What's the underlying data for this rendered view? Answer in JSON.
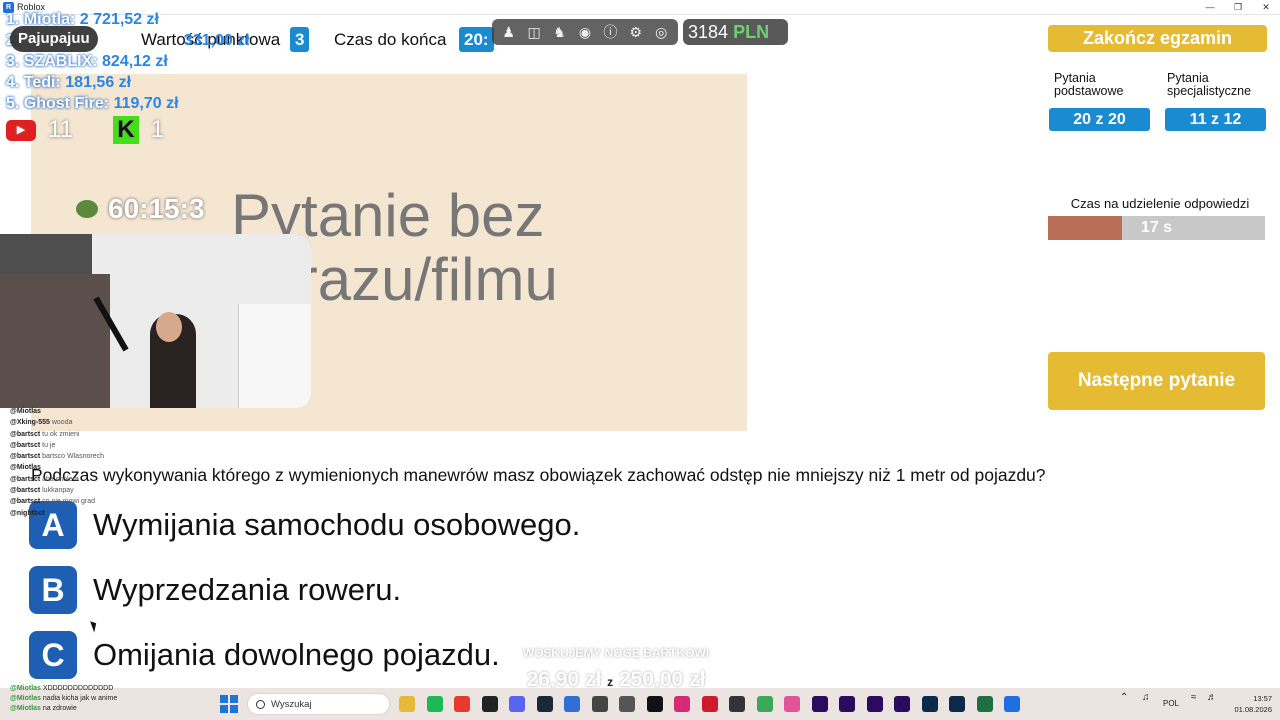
{
  "window": {
    "title": "Roblox",
    "icon": "roblox-icon"
  },
  "header": {
    "points_label": "Wartość punktowa",
    "points_value": "3",
    "time_label": "Czas do końca",
    "time_value": "20:",
    "currency_amount": "3184",
    "currency_unit": "PLN"
  },
  "roblox_menu": [
    "person-icon",
    "backpack-icon",
    "trophy-icon",
    "location-icon",
    "info-icon",
    "gear-icon",
    "shield-icon"
  ],
  "image_panel": {
    "placeholder": "Pytanie bez obrazu/filmu"
  },
  "sidebar": {
    "finish_button": "Zakończ egzamin",
    "basic_label": "Pytania podstawowe",
    "basic_counter": "20 z 20",
    "special_label": "Pytania specjalistyczne",
    "special_counter": "11 z 12",
    "time_label": "Czas na udzielenie odpowiedzi",
    "time_value": "17 s",
    "time_fraction": 0.34,
    "next_button": "Następne pytanie"
  },
  "question": {
    "text": "Podczas wykonywania którego z wymienionych manewrów masz obowiązek zachować odstęp nie mniejszy niż 1 metr od pojazdu?",
    "answers": [
      {
        "letter": "A",
        "text": "Wymijania samochodu osobowego."
      },
      {
        "letter": "B",
        "text": "Wyprzedzania roweru."
      },
      {
        "letter": "C",
        "text": "Omijania dowolnego pojazdu."
      }
    ]
  },
  "overlay": {
    "streamer": "Pajupajuu",
    "leaderboard": [
      {
        "name": "1. Miotla:",
        "value": "2 721,52 zł"
      },
      {
        "name": "2.",
        "value": "331,00 zł"
      },
      {
        "name": "3. SZABLIX:",
        "value": "824,12 zł"
      },
      {
        "name": "4. Tedi:",
        "value": "181,56 zł"
      },
      {
        "name": "5. Ghost Fire:",
        "value": "119,70 zł"
      }
    ],
    "youtube_count": "11",
    "kick_count": "1",
    "timer": "60:15:3",
    "donation_title": "WOSKUJEMY NOGĘ BARTKOWI",
    "donation_current": "26,90 zł",
    "donation_sep": "z",
    "donation_goal": "250,00 zł",
    "chat": [
      {
        "user": "@Miotlas",
        "text": ""
      },
      {
        "user": "@Xking-555",
        "text": "wooda"
      },
      {
        "user": "@bartsct",
        "text": "tu ok zmieni"
      },
      {
        "user": "@bartsct",
        "text": "tu je"
      },
      {
        "user": "@bartsct",
        "text": "bartsco Wlasnorech"
      },
      {
        "user": "@Miotlas",
        "text": ""
      },
      {
        "user": "@bartsct",
        "text": "aha cholera"
      },
      {
        "user": "@bartsct",
        "text": "lukkanpay"
      },
      {
        "user": "",
        "text": ""
      },
      {
        "user": "",
        "text": ""
      },
      {
        "user": "",
        "text": ""
      },
      {
        "user": "",
        "text": ""
      },
      {
        "user": "",
        "text": ""
      },
      {
        "user": "@bartsct",
        "text": "co nie mowi grad"
      },
      {
        "user": "",
        "text": ""
      },
      {
        "user": "",
        "text": ""
      },
      {
        "user": "",
        "text": ""
      },
      {
        "user": "",
        "text": ""
      },
      {
        "user": "",
        "text": ""
      },
      {
        "user": "@nightbot",
        "text": ""
      }
    ],
    "chat_bottom": [
      {
        "user": "@Miotlas",
        "text": "XDDDDDDDDDDDDD"
      },
      {
        "user": "@Miotlas",
        "text": "nadia kicha jak w anime"
      },
      {
        "user": "@Miotlas",
        "text": "na zdrowie"
      }
    ]
  },
  "taskbar": {
    "search_placeholder": "Wyszukaj",
    "apps": [
      "file-explorer-icon",
      "spotify-icon",
      "ea-icon",
      "epic-games-icon",
      "discord-icon",
      "steam-icon",
      "store-icon",
      "obs-icon",
      "clock-app-icon",
      "tiktok-icon",
      "instagram-icon",
      "opera-icon",
      "hud-icon",
      "browser-icon",
      "photos-icon",
      "premiere-icon",
      "after-effects-icon",
      "media-encoder-icon",
      "audition-icon",
      "photoshop-icon",
      "lightroom-icon",
      "excel-icon",
      "roblox-icon"
    ],
    "language": "POL",
    "time": "13:57",
    "date": "01.08.2026"
  }
}
